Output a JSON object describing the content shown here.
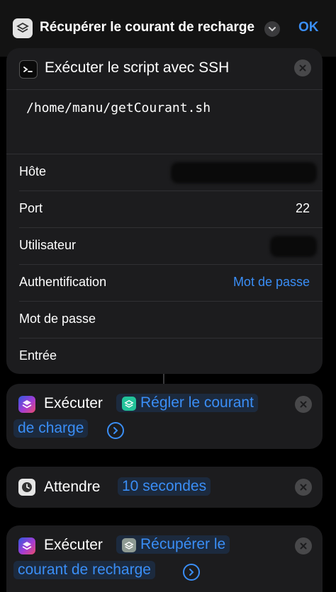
{
  "header": {
    "title": "Récupérer le courant de recharge",
    "ok_label": "OK"
  },
  "ssh_action": {
    "title": "Exécuter le script avec SSH",
    "script": "/home/manu/getCourant.sh",
    "rows": [
      {
        "label": "Hôte",
        "value": ""
      },
      {
        "label": "Port",
        "value": "22"
      },
      {
        "label": "Utilisateur",
        "value": ""
      },
      {
        "label": "Authentification",
        "value": "Mot de passe"
      },
      {
        "label": "Mot de passe",
        "value": ""
      },
      {
        "label": "Entrée",
        "value": ""
      }
    ]
  },
  "run_action_1": {
    "label": "Exécuter",
    "token_line1": "Régler le courant",
    "token_line2": "de charge"
  },
  "wait_action": {
    "label": "Attendre",
    "token": "10 secondes"
  },
  "run_action_2": {
    "label": "Exécuter",
    "token_line1": "Récupérer le",
    "token_line2": "courant de recharge"
  },
  "icons": {
    "app": "shortcuts-app-icon",
    "terminal": "terminal-icon",
    "close": "close-icon",
    "chevron": "chevron-down-icon",
    "arrow": "arrow-right-circle-icon",
    "clock": "clock-icon"
  },
  "colors": {
    "accent": "#3a8ef6",
    "card": "#1c1c1e",
    "background": "#000000"
  }
}
